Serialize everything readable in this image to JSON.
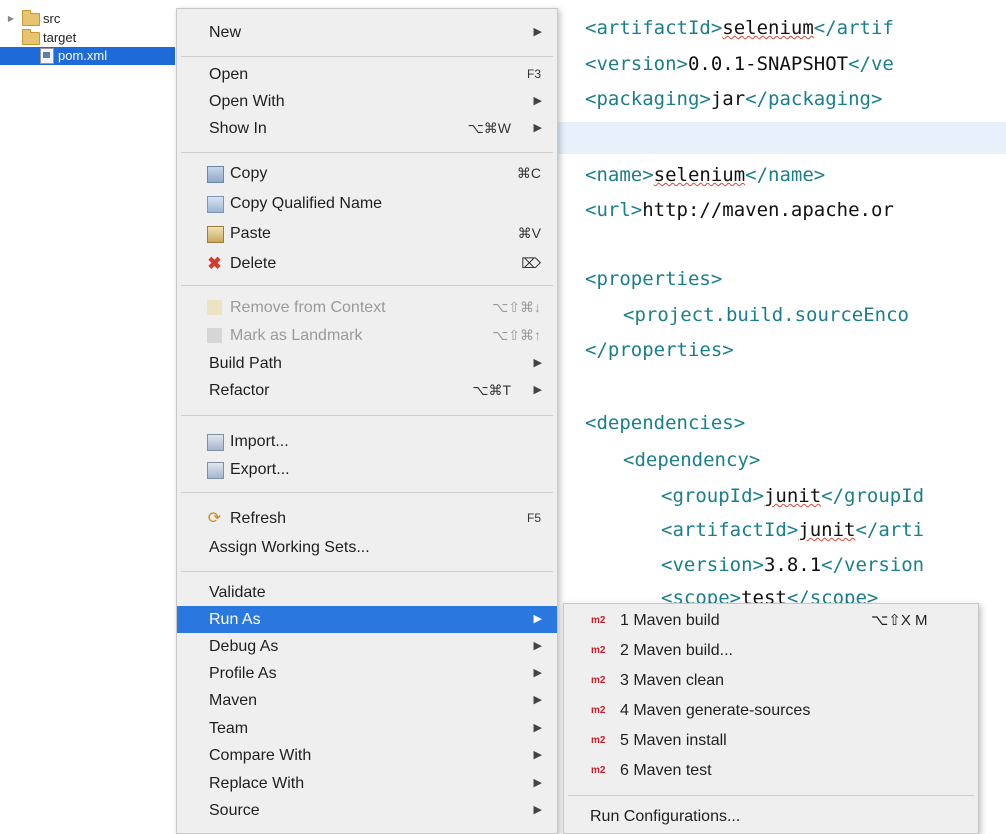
{
  "tree": {
    "items": [
      {
        "label": "src",
        "icon": "folder-icon",
        "expandable": true
      },
      {
        "label": "target",
        "icon": "folder-icon",
        "expandable": false
      },
      {
        "label": "pom.xml",
        "icon": "xml-file-icon",
        "selected": true
      }
    ]
  },
  "menu": {
    "new": {
      "label": "New"
    },
    "open": {
      "label": "Open",
      "shortcut": "F3"
    },
    "open_with": {
      "label": "Open With"
    },
    "show_in": {
      "label": "Show In",
      "shortcut": "⌥⌘W"
    },
    "copy": {
      "label": "Copy",
      "shortcut": "⌘C"
    },
    "copy_qualified": {
      "label": "Copy Qualified Name"
    },
    "paste": {
      "label": "Paste",
      "shortcut": "⌘V"
    },
    "delete": {
      "label": "Delete",
      "shortcut": "⌦"
    },
    "remove_context": {
      "label": "Remove from Context",
      "shortcut": "⌥⇧⌘↓"
    },
    "mark_landmark": {
      "label": "Mark as Landmark",
      "shortcut": "⌥⇧⌘↑"
    },
    "build_path": {
      "label": "Build Path"
    },
    "refactor": {
      "label": "Refactor",
      "shortcut": "⌥⌘T"
    },
    "import": {
      "label": "Import..."
    },
    "export": {
      "label": "Export..."
    },
    "refresh": {
      "label": "Refresh",
      "shortcut": "F5"
    },
    "working_sets": {
      "label": "Assign Working Sets..."
    },
    "validate": {
      "label": "Validate"
    },
    "run_as": {
      "label": "Run As"
    },
    "debug_as": {
      "label": "Debug As"
    },
    "profile_as": {
      "label": "Profile As"
    },
    "maven": {
      "label": "Maven"
    },
    "team": {
      "label": "Team"
    },
    "compare_with": {
      "label": "Compare With"
    },
    "replace_with": {
      "label": "Replace With"
    },
    "source": {
      "label": "Source"
    }
  },
  "submenu": {
    "badge": "m2",
    "items": [
      {
        "label": "1 Maven build",
        "shortcut": "⌥⇧X M"
      },
      {
        "label": "2 Maven build..."
      },
      {
        "label": "3 Maven clean"
      },
      {
        "label": "4 Maven generate-sources"
      },
      {
        "label": "5 Maven install"
      },
      {
        "label": "6 Maven test"
      }
    ],
    "run_configurations": "Run Configurations..."
  },
  "editor": {
    "lines": [
      {
        "open": "<artifactId>",
        "value": "selenium",
        "close": "</artif"
      },
      {
        "open": "<version>",
        "value": "0.0.1-SNAPSHOT",
        "close": "</ve"
      },
      {
        "open": "<packaging>",
        "value": "jar",
        "close": "</packaging>"
      },
      {
        "open": "<name>",
        "value": "selenium",
        "close": "</name>"
      },
      {
        "open": "<url>",
        "value": "http://maven.apache.or",
        "close": ""
      },
      {
        "open": "<properties>",
        "value": "",
        "close": ""
      },
      {
        "open": "<project.build.sourceEnco",
        "value": "",
        "close": ""
      },
      {
        "open": "</properties>",
        "value": "",
        "close": ""
      },
      {
        "open": "<dependencies>",
        "value": "",
        "close": ""
      },
      {
        "open": "<dependency>",
        "value": "",
        "close": ""
      },
      {
        "open": "<groupId>",
        "value": "junit",
        "close": "</groupId"
      },
      {
        "open": "<artifactId>",
        "value": "junit",
        "close": "</arti"
      },
      {
        "open": "<version>",
        "value": "3.8.1",
        "close": "</version"
      },
      {
        "open": "<scope>",
        "value": "test",
        "close": "</scope>"
      }
    ]
  },
  "colors": {
    "selection": "#1d6ad8",
    "menu_highlight": "#2b77e0",
    "xml_tag": "#1a7f8a",
    "maven_badge": "#c8202a"
  }
}
